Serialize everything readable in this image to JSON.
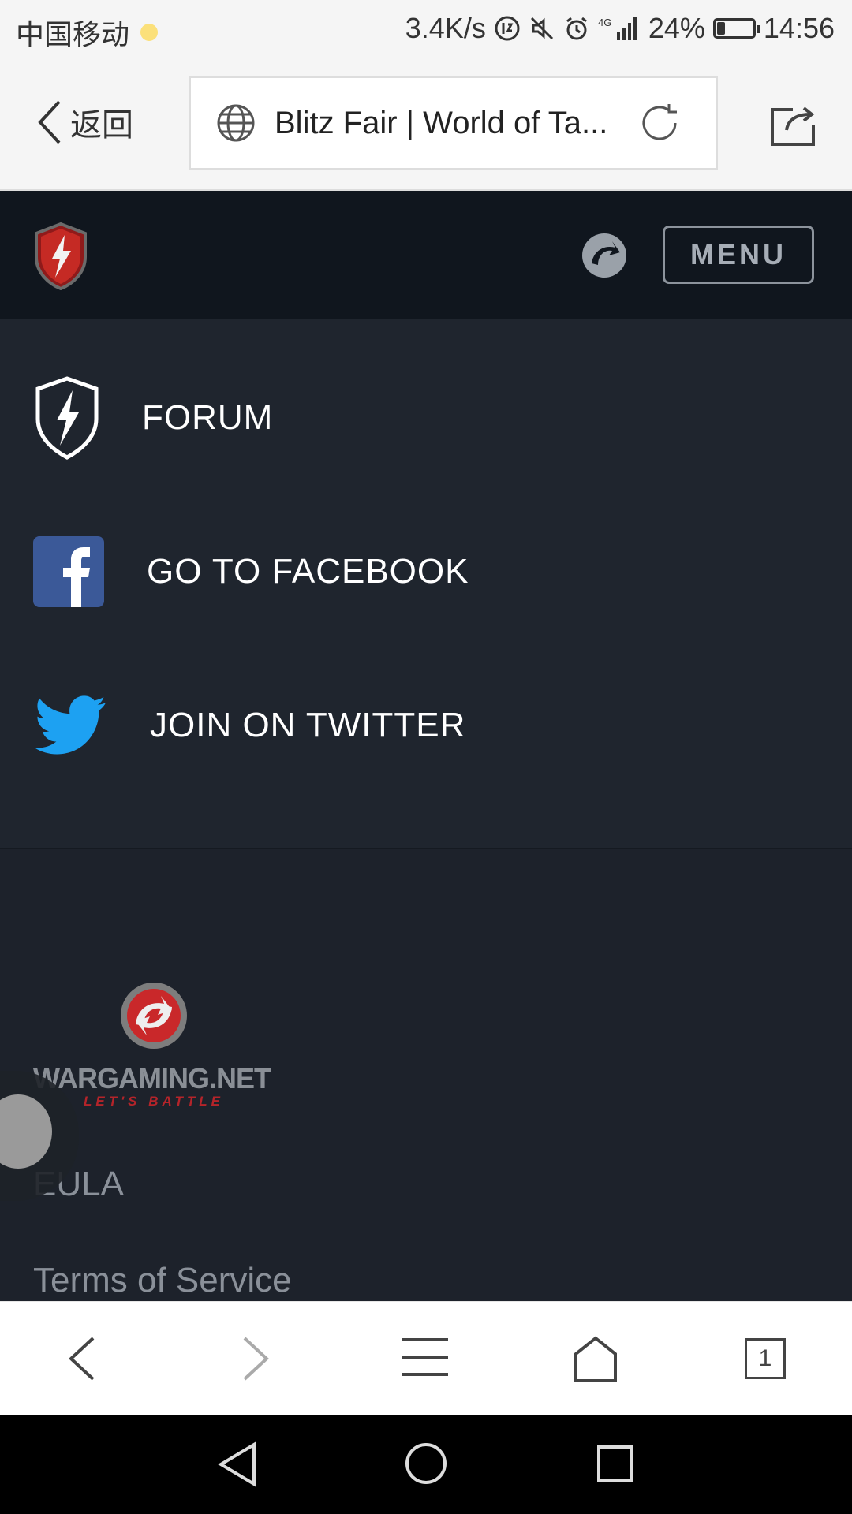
{
  "status_bar": {
    "carrier": "中国移动",
    "speed": "3.4K/s",
    "network": "4G",
    "battery": "24%",
    "time": "14:56"
  },
  "browser": {
    "back_label": "返回",
    "url_text": "Blitz Fair | World of Ta...",
    "tab_count": "1"
  },
  "site_header": {
    "menu_label": "MENU"
  },
  "social": {
    "items": [
      {
        "label": "FORUM",
        "icon": "forum-shield-icon"
      },
      {
        "label": "GO TO FACEBOOK",
        "icon": "facebook-icon"
      },
      {
        "label": "JOIN ON TWITTER",
        "icon": "twitter-icon"
      }
    ]
  },
  "footer": {
    "brand_name": "WARGAMING.NET",
    "brand_tagline": "LET'S BATTLE",
    "links": [
      "EULA",
      "Terms of Service"
    ]
  },
  "colors": {
    "facebook": "#3b5998",
    "twitter": "#1da1f2",
    "brand_red": "#b5242a"
  }
}
